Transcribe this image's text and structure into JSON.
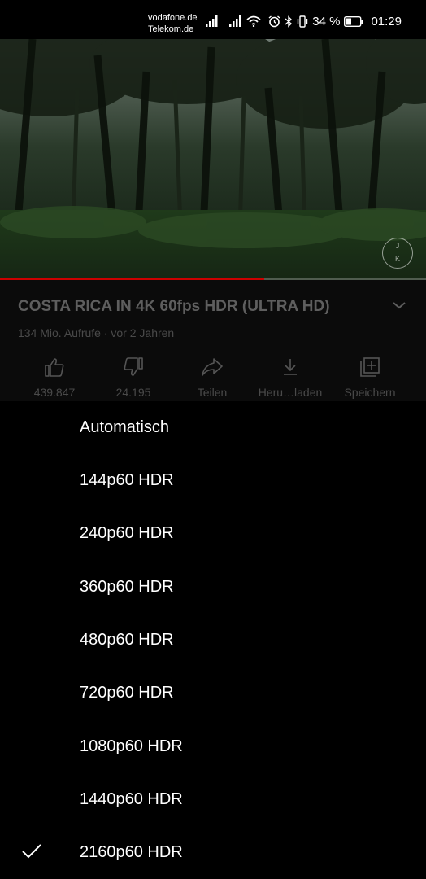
{
  "status_bar": {
    "carrier_1": "vodafone.de",
    "carrier_2": "Telekom.de",
    "battery": "34 %",
    "time": "01:29",
    "icons": [
      "signal-icon",
      "signal-icon",
      "wifi-icon",
      "alarm-icon",
      "bluetooth-icon",
      "vibrate-icon",
      "battery-icon"
    ]
  },
  "player": {
    "watermark_letters": [
      "J",
      "K"
    ],
    "progress_fraction": 0.62,
    "accent": "#cc0000"
  },
  "video": {
    "title": "COSTA RICA IN 4K 60fps HDR (ULTRA HD)",
    "meta": "134 Mio. Aufrufe · vor 2 Jahren"
  },
  "actions": [
    {
      "icon": "like-icon",
      "label": "439.847"
    },
    {
      "icon": "dislike-icon",
      "label": "24.195"
    },
    {
      "icon": "share-icon",
      "label": "Teilen"
    },
    {
      "icon": "download-icon",
      "label": "Heru…laden"
    },
    {
      "icon": "save-playlist-icon",
      "label": "Speichern"
    }
  ],
  "quality_menu": {
    "items": [
      {
        "label": "Automatisch",
        "selected": false
      },
      {
        "label": "144p60 HDR",
        "selected": false
      },
      {
        "label": "240p60 HDR",
        "selected": false
      },
      {
        "label": "360p60 HDR",
        "selected": false
      },
      {
        "label": "480p60 HDR",
        "selected": false
      },
      {
        "label": "720p60 HDR",
        "selected": false
      },
      {
        "label": "1080p60 HDR",
        "selected": false
      },
      {
        "label": "1440p60 HDR",
        "selected": false
      },
      {
        "label": "2160p60 HDR",
        "selected": true
      }
    ]
  }
}
